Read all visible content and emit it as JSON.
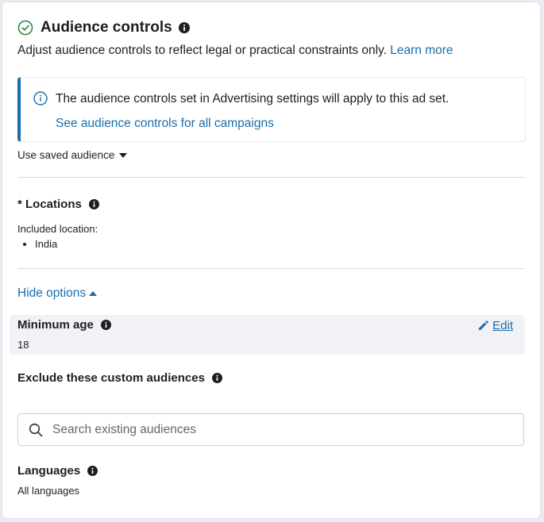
{
  "header": {
    "title": "Audience controls",
    "description": "Adjust audience controls to reflect legal or practical constraints only.",
    "learn_more": "Learn more"
  },
  "notice": {
    "text": "The audience controls set in Advertising settings will apply to this ad set.",
    "link": "See audience controls for all campaigns"
  },
  "saved_audience": {
    "label": "Use saved audience"
  },
  "locations": {
    "title": "* Locations",
    "included_label": "Included location:",
    "items": [
      "India"
    ]
  },
  "options_toggle": "Hide options",
  "minimum_age": {
    "title": "Minimum age",
    "value": "18",
    "edit_label": "Edit"
  },
  "exclude": {
    "title": "Exclude these custom audiences",
    "search_placeholder": "Search existing audiences"
  },
  "languages": {
    "title": "Languages",
    "value": "All languages"
  },
  "colors": {
    "accent": "#1a6ea8",
    "success": "#2e8540",
    "text": "#1c1e21"
  }
}
